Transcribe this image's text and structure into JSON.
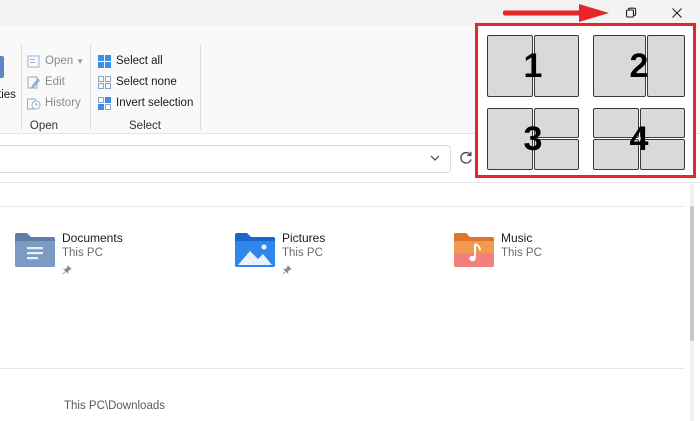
{
  "ribbon": {
    "cut_label": "ties",
    "open_group": {
      "open_label": "Open",
      "edit_label": "Edit",
      "history_label": "History",
      "group_label": "Open"
    },
    "select_group": {
      "select_all_label": "Select all",
      "select_none_label": "Select none",
      "invert_label": "Invert selection",
      "group_label": "Select"
    }
  },
  "quick_access": [
    {
      "name": "Documents",
      "location": "This PC",
      "icon": "documents-folder-icon"
    },
    {
      "name": "Pictures",
      "location": "This PC",
      "icon": "pictures-folder-icon"
    },
    {
      "name": "Music",
      "location": "This PC",
      "icon": "music-folder-icon"
    }
  ],
  "recent": {
    "path": "This PC\\Downloads"
  },
  "snap_layouts": [
    {
      "number": "1"
    },
    {
      "number": "2"
    },
    {
      "number": "3"
    },
    {
      "number": "4"
    }
  ],
  "colors": {
    "highlight": "#e8262a",
    "accent_blue": "#1e6fd9",
    "docs_folder": "#6e8fb5",
    "music_folder": "#f08a3c"
  }
}
